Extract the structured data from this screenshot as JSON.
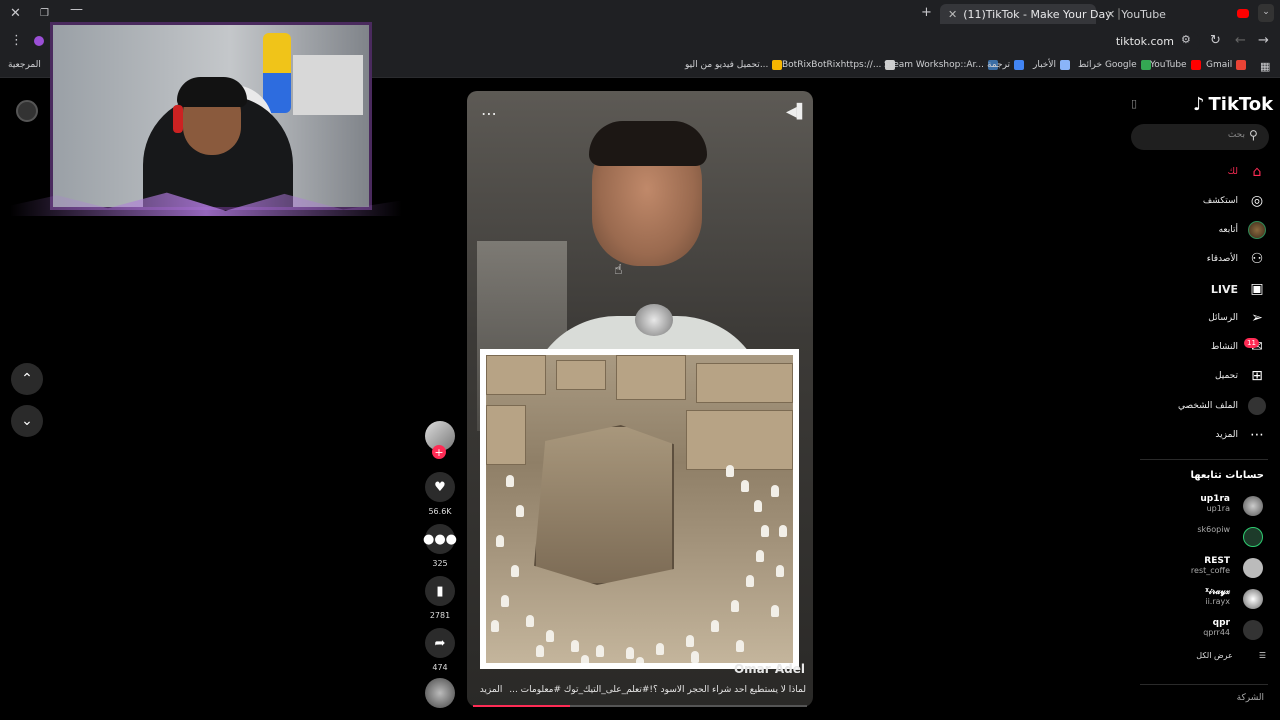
{
  "browser": {
    "tabs": [
      {
        "title": "(11)TikTok - Make Your Day",
        "active": true
      },
      {
        "title": "YouTube",
        "active": false
      }
    ],
    "url": "tiktok.com",
    "bookmarks": [
      {
        "label": "تحميل فيديو من اليو...",
        "icon_color": "#f7b500"
      },
      {
        "label": "BotRixBotRixhttps://...",
        "icon_color": "#cccccc"
      },
      {
        "label": "Steam Workshop::Ar...",
        "icon_color": "#3b6ea5"
      },
      {
        "label": "ترجمة",
        "icon_color": "#4285f4"
      },
      {
        "label": "الأخبار",
        "icon_color": "#8ab4f8"
      },
      {
        "label": "خرائط Google",
        "icon_color": "#34a853"
      },
      {
        "label": "YouTube",
        "icon_color": "#ff0000"
      },
      {
        "label": "Gmail",
        "icon_color": "#ea4335"
      }
    ],
    "bookmarks_left": "المرجعية"
  },
  "video": {
    "author": "Omar Adel",
    "caption": "لماذا لا يستطيع احد شراء الحجر الاسود ؟!#تعلم_على_التيك_توك #معلومات ...",
    "more_label": "المزيد",
    "progress_fraction": 0.29
  },
  "actions": {
    "likes": "56.6K",
    "comments": "325",
    "saves": "2781",
    "shares": "474"
  },
  "sidebar": {
    "logo": "TikTok",
    "search_placeholder": "بحث",
    "nav": [
      {
        "label": "لك",
        "icon": "home-icon",
        "glyph": "⌂",
        "highlight": true
      },
      {
        "label": "استكشف",
        "icon": "compass-icon",
        "glyph": "◎"
      },
      {
        "label": "أتابعه",
        "icon": "avatar-icon",
        "glyph": "●"
      },
      {
        "label": "الأصدقاء",
        "icon": "friends-icon",
        "glyph": "⚇"
      },
      {
        "label": "LIVE",
        "icon": "live-icon",
        "glyph": "▣"
      },
      {
        "label": "الرسائل",
        "icon": "send-icon",
        "glyph": "➢"
      },
      {
        "label": "النشاط",
        "icon": "activity-icon",
        "glyph": "✉",
        "badge": "11"
      },
      {
        "label": "تحميل",
        "icon": "upload-icon",
        "glyph": "⊞"
      },
      {
        "label": "الملف الشخصي",
        "icon": "profile-icon",
        "glyph": "●"
      },
      {
        "label": "المزيد",
        "icon": "more-icon",
        "glyph": "⋯"
      }
    ],
    "following_title": "حسابات تتابعها",
    "accounts": [
      {
        "name": "up1ra",
        "handle": "up1ra"
      },
      {
        "name": "",
        "handle": "sk6opiw"
      },
      {
        "name": "REST",
        "handle": "rest_coffe"
      },
      {
        "name": "ᵡ𝒾𝓇𝒶𝓎𝓍",
        "handle": "ii.rayx"
      },
      {
        "name": "qpr",
        "handle": "qprr44"
      }
    ],
    "see_all": "عرض الكل",
    "company": "الشركة"
  },
  "colors": {
    "accent": "#fe2c55",
    "background": "#000000"
  }
}
